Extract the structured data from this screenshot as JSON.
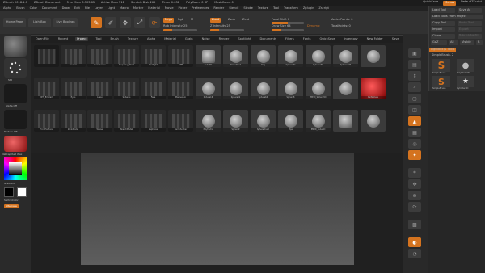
{
  "titlebar": {
    "app": "ZBrush 2018.1.1",
    "doc": "ZBrush Document",
    "free_mem": "Free Mem 8.503GB",
    "active_mem": "Active Mem 511",
    "scratch": "Scratch Disk 265",
    "timer": "Timer 0.038",
    "poly": "PolyCount 0 KP",
    "mesh": "MeshCount 0",
    "quicksave": "QuickSave",
    "menus": "Menus",
    "default_script": "DefaultZScript"
  },
  "menu": [
    "Alpha",
    "Brush",
    "Color",
    "Document",
    "Draw",
    "Edit",
    "File",
    "Layer",
    "Light",
    "Macro",
    "Marker",
    "Material",
    "Movie",
    "Picker",
    "Preferences",
    "Render",
    "Stencil",
    "Stroke",
    "Texture",
    "Tool",
    "Transform",
    "Zplugin",
    "Zscript"
  ],
  "shelf": {
    "home": "Home Page",
    "lightbox": "LightBox",
    "live_boolean": "Live Boolean",
    "mrgb": "Mrgb",
    "rgb": "Rgb",
    "m": "M",
    "zadd": "Zadd",
    "zsub": "Zsub",
    "zcut": "Zcut",
    "rgb_intensity": "Rgb Intensity 25",
    "z_intensity": "Z Intensity 25",
    "focal_shift": "Focal Shift 0",
    "draw_size": "Draw Size 64",
    "dynamic": "Dynamic",
    "active_points": "ActivePoints: 0",
    "total_points": "TotalPoints: 0"
  },
  "popup": {
    "tabs": [
      "Open File",
      "Recent",
      "Project",
      "Tool",
      "Brush",
      "Texture",
      "Alpha",
      "Material",
      "Grain",
      "Noise",
      "Render",
      "Spotlight",
      "Documents",
      "Filters",
      "Fonts",
      "QuickSave",
      "Inventory"
    ],
    "active_tab": "Project",
    "right_btns": [
      "New Folder",
      "Save"
    ],
    "items": [
      [
        "",
        "Brushes",
        "Headhunter",
        "Preparing_Head",
        "Spotlight",
        "DPB",
        "Cube3D",
        "DemoHead",
        "Dog",
        "Sphere3D",
        "Cylinder3D",
        "Sphere128",
        "",
        "ZBrushGear"
      ],
      [
        "DPH_Emblem",
        "Eyes",
        "Lasso",
        "Spheres",
        "Face",
        "Mannequin",
        "Sphere16",
        "Sphere32",
        "Sphere64",
        "Sphere8",
        "PM3D_Sphere3D",
        "",
        "RedSphere"
      ],
      [
        "FrontHalftone",
        "ZonkModel",
        "Weave",
        "SketchModel",
        "Zspheres",
        "DemoSoldier",
        "Polyhedra",
        "SphereZ",
        "SphereBrush",
        "Pipe",
        "PM3D_Cube3D",
        "",
        "",
        ""
      ]
    ]
  },
  "left": {
    "std": "Std",
    "alpha_off": "Alpha Off",
    "texture_off": "Texture Off",
    "matcap": "MatCap Red Wax",
    "gradient": "Gradient",
    "switch_color": "SwitchColor",
    "alternate": "Alternate"
  },
  "right_panel": {
    "items": [
      "Load Tool",
      "Save As",
      "Load Tools From Project",
      "Copy Tool",
      "Paste Tool",
      "Import",
      "Export",
      "Clone",
      "Make PolyMesh3D",
      "GoZ",
      "All",
      "Visible",
      "R"
    ],
    "lightbox": "Lightbox ▶ Tools",
    "current": "SimpleBrush. 2",
    "thumbs": [
      "SimpleBrush",
      "PolyMesh3D",
      "SimpleBrush",
      "Cylinder3D"
    ]
  },
  "colors": {
    "accent": "#d4731f",
    "bg": "#262626"
  }
}
